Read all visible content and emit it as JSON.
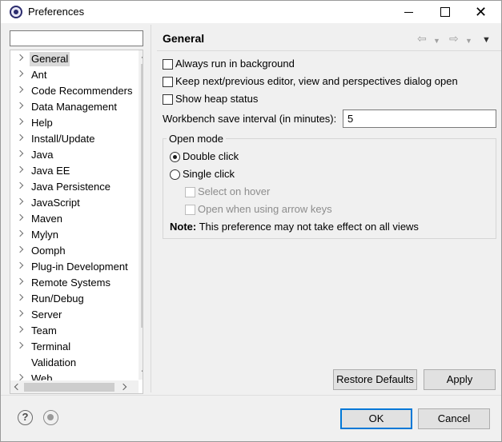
{
  "window": {
    "title": "Preferences"
  },
  "filter": {
    "value": "",
    "placeholder": ""
  },
  "tree": {
    "items": [
      {
        "label": "General",
        "selected": true
      },
      {
        "label": "Ant"
      },
      {
        "label": "Code Recommenders"
      },
      {
        "label": "Data Management"
      },
      {
        "label": "Help"
      },
      {
        "label": "Install/Update"
      },
      {
        "label": "Java"
      },
      {
        "label": "Java EE"
      },
      {
        "label": "Java Persistence"
      },
      {
        "label": "JavaScript"
      },
      {
        "label": "Maven"
      },
      {
        "label": "Mylyn"
      },
      {
        "label": "Oomph"
      },
      {
        "label": "Plug-in Development"
      },
      {
        "label": "Remote Systems"
      },
      {
        "label": "Run/Debug"
      },
      {
        "label": "Server"
      },
      {
        "label": "Team"
      },
      {
        "label": "Terminal"
      },
      {
        "label": "Validation"
      },
      {
        "label": "Web"
      }
    ]
  },
  "page": {
    "title": "General",
    "always_run_background": {
      "label": "Always run in background",
      "checked": false
    },
    "keep_next_prev": {
      "label": "Keep next/previous editor, view and perspectives dialog open",
      "checked": false
    },
    "show_heap": {
      "label": "Show heap status",
      "checked": false
    },
    "interval": {
      "label": "Workbench save interval (in minutes):",
      "value": "5"
    },
    "open_mode": {
      "legend": "Open mode",
      "double_click": {
        "label": "Double click",
        "selected": true
      },
      "single_click": {
        "label": "Single click",
        "selected": false
      },
      "select_on_hover": {
        "label": "Select on hover",
        "checked": false,
        "enabled": false
      },
      "open_arrow_keys": {
        "label": "Open when using arrow keys",
        "checked": false,
        "enabled": false
      },
      "note_bold": "Note:",
      "note_text": " This preference may not take effect on all views"
    },
    "restore_defaults": "Restore Defaults",
    "apply": "Apply"
  },
  "footer": {
    "ok": "OK",
    "cancel": "Cancel"
  },
  "icons": {
    "back": "back-arrow-icon",
    "forward": "forward-arrow-icon",
    "menu": "view-menu-icon",
    "help": "help-icon",
    "record": "record-macro-icon"
  }
}
